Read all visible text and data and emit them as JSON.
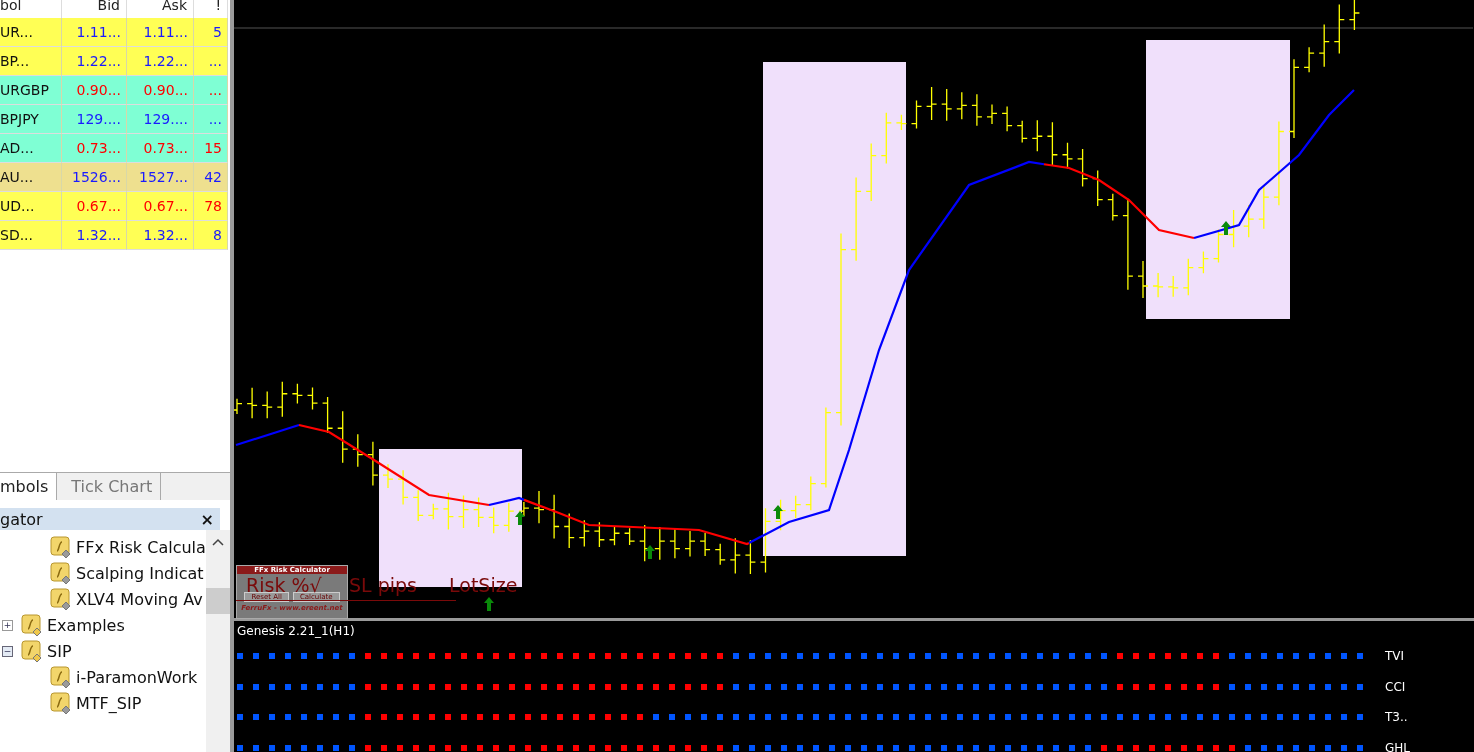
{
  "market_watch": {
    "columns": [
      "bol",
      "Bid",
      "Ask",
      "!"
    ],
    "rows": [
      {
        "symbol": "UR...",
        "bid": "1.11...",
        "ask": "1.11...",
        "spread": "5",
        "color": "#ffff55",
        "rising": true
      },
      {
        "symbol": "BP...",
        "bid": "1.22...",
        "ask": "1.22...",
        "spread": "...",
        "color": "#ffff55",
        "rising": true
      },
      {
        "symbol": "URGBP",
        "bid": "0.90...",
        "ask": "0.90...",
        "spread": "...",
        "color": "#7fffd4",
        "rising": false
      },
      {
        "symbol": "BPJPY",
        "bid": "129....",
        "ask": "129....",
        "spread": "...",
        "color": "#7fffd4",
        "rising": true
      },
      {
        "symbol": "AD...",
        "bid": "0.73...",
        "ask": "0.73...",
        "spread": "15",
        "color": "#7fffd4",
        "rising": false
      },
      {
        "symbol": "AU...",
        "bid": "1526...",
        "ask": "1527...",
        "spread": "42",
        "color": "#eee08f",
        "rising": true
      },
      {
        "symbol": "UD...",
        "bid": "0.67...",
        "ask": "0.67...",
        "spread": "78",
        "color": "#ffff55",
        "rising": false
      },
      {
        "symbol": "SD...",
        "bid": "1.32...",
        "ask": "1.32...",
        "spread": "8",
        "color": "#ffff55",
        "rising": true
      }
    ]
  },
  "tabs": [
    {
      "label": "mbols",
      "selected": true
    },
    {
      "label": "Tick Chart",
      "selected": false
    }
  ],
  "navigator": {
    "title": "gator",
    "close": "×",
    "tree": [
      {
        "children": [
          {
            "label": "FFx Risk Calcula"
          },
          {
            "label": "Scalping Indicat"
          },
          {
            "label": "XLV4 Moving Av"
          }
        ]
      },
      {
        "label": "Examples",
        "expanded": false,
        "toggle": "+"
      },
      {
        "label": "SIP",
        "expanded": true,
        "toggle": "−",
        "children": [
          {
            "label": "i-ParamonWork"
          },
          {
            "label": "MTF_SIP"
          }
        ]
      }
    ]
  },
  "risk_calculator": {
    "title": "FFx Risk Calculator",
    "buttons": [
      "Reset All",
      "Calculate"
    ],
    "footer": "FerruFx - www.ereent.net",
    "overlay_labels": [
      "Risk %√",
      "SL pips",
      "LotSize"
    ]
  },
  "indicator_pane": {
    "title": "Genesis 2.21_1(H1)",
    "rows": [
      {
        "label": "TVI"
      },
      {
        "label": "CCI"
      },
      {
        "label": "T3.."
      },
      {
        "label": "GHL"
      }
    ]
  }
}
